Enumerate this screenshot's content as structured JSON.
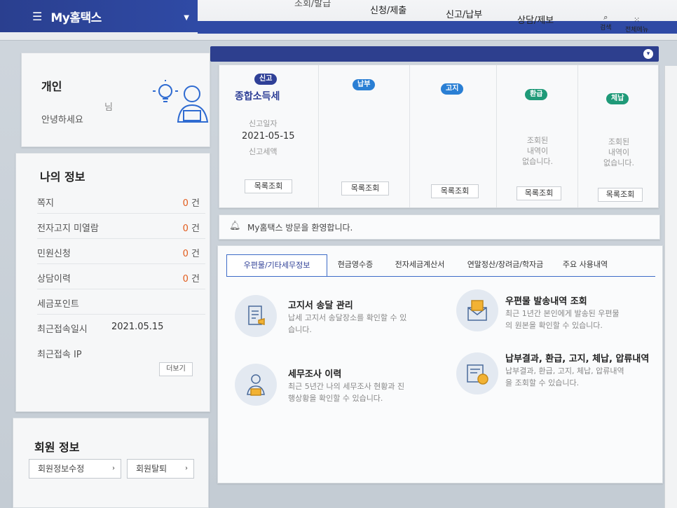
{
  "header": {
    "brand": "My홈택스",
    "nav": [
      "신청/제출",
      "신고/납부",
      "상담/제보"
    ],
    "nav_cut": "조회/발급",
    "search_label": "검색",
    "all_menu_label": "전체메뉴"
  },
  "user": {
    "title": "개인",
    "suffix": "님",
    "greeting": "안녕하세요"
  },
  "my_info": {
    "title": "나의 정보",
    "rows": [
      {
        "label": "쪽지",
        "count": "0",
        "unit": "건"
      },
      {
        "label": "전자고지 미열람",
        "count": "0",
        "unit": "건"
      },
      {
        "label": "민원신청",
        "count": "0",
        "unit": "건"
      },
      {
        "label": "상담이력",
        "count": "0",
        "unit": "건"
      },
      {
        "label": "세금포인트"
      },
      {
        "label": "최근접속일시",
        "value": "2021.05.15"
      },
      {
        "label": "최근접속 IP"
      }
    ],
    "more": "더보기"
  },
  "member": {
    "title": "회원 정보",
    "edit": "회원정보수정",
    "withdraw": "회원탈퇴"
  },
  "status": {
    "report": {
      "badge": "신고",
      "title": "종합소득세",
      "date_label": "신고일자",
      "date": "2021-05-15",
      "amount_label": "신고세액",
      "btn": "목록조회"
    },
    "payment": {
      "badge": "납부",
      "btn": "목록조회"
    },
    "notice": {
      "badge": "고지",
      "btn": "목록조회"
    },
    "refund": {
      "badge": "환급",
      "empty": [
        "조회된",
        "내역이",
        "없습니다."
      ],
      "btn": "목록조회"
    },
    "arrears": {
      "badge": "체납",
      "empty": [
        "조회된",
        "내역이",
        "없습니다."
      ],
      "btn": "목록조회"
    }
  },
  "notice_bar": {
    "text": "My홈택스 방문을 환영합니다."
  },
  "tabs": [
    "우편물/기타세무정보",
    "현금영수증",
    "전자세금계산서",
    "연말정산/장려금/학자금",
    "주요 사용내역"
  ],
  "services": [
    {
      "title": "고지서 송달 관리",
      "desc": [
        "납세 고지서 송달장소를 확인할 수 있",
        "습니다."
      ]
    },
    {
      "title": "우편물 발송내역 조회",
      "desc": [
        "최근 1년간 본인에게 발송된 우편물",
        "의 원본을 확인할 수 있습니다."
      ]
    },
    {
      "title": "세무조사 이력",
      "desc": [
        "최근 5년간 나의 세무조사 현황과 진",
        "행상황을 확인할 수 있습니다."
      ]
    },
    {
      "title": "납부결과, 환급, 고지, 체납, 압류내역",
      "desc": [
        "납부결과, 환급, 고지, 체납, 압류내역",
        "을 조회할 수 있습니다."
      ]
    }
  ],
  "colors": {
    "brand": "#2f4aa5",
    "accent": "#e25b1c",
    "badge_navy": "#2f4097",
    "badge_blue": "#2a7fd4",
    "badge_green": "#1f9a78"
  }
}
